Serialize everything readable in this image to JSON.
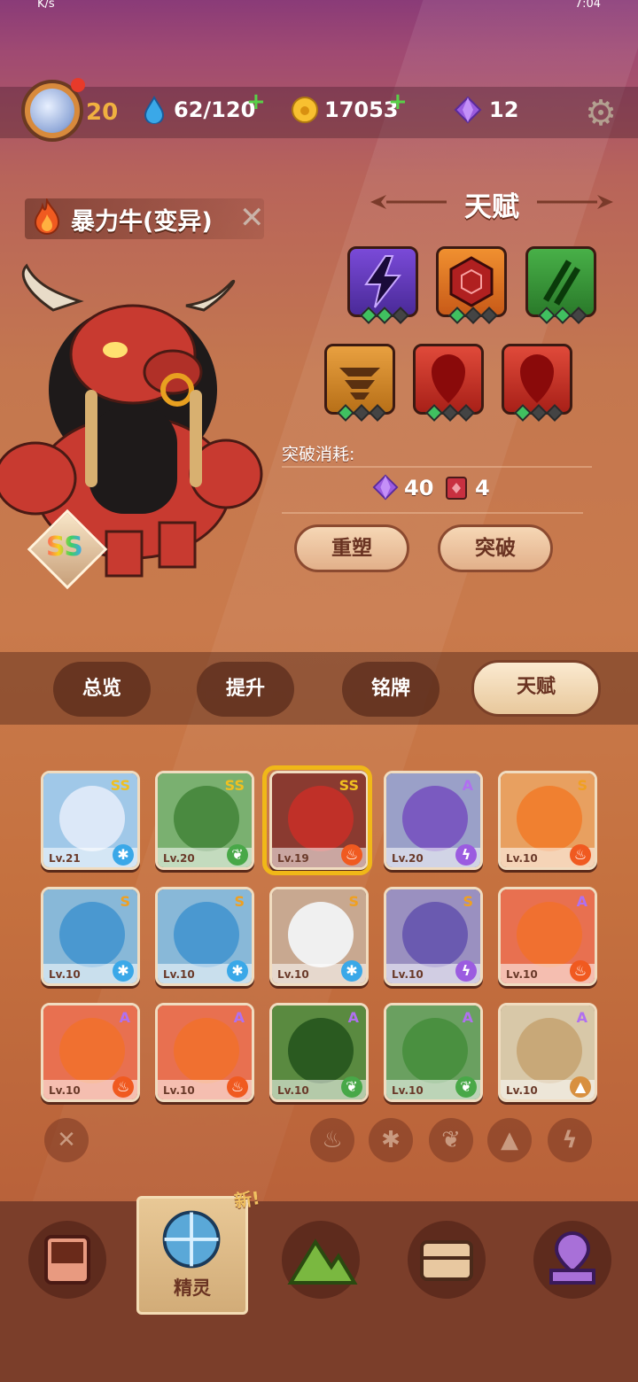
{
  "status_bar": {
    "left_text": "K/s",
    "right_text": "7:04"
  },
  "resources": {
    "player_level": "20",
    "water": "62/120",
    "gold": "17053",
    "gems": "12"
  },
  "pet": {
    "name": "暴力牛(变异)",
    "grade": "SS"
  },
  "talent": {
    "title": "天赋",
    "cost_label": "突破消耗:",
    "cost_gems": "40",
    "cost_books": "4",
    "reshape_label": "重塑",
    "breakthrough_label": "突破"
  },
  "tabs": [
    {
      "label": "总览"
    },
    {
      "label": "提升"
    },
    {
      "label": "铭牌"
    },
    {
      "label": "天赋"
    }
  ],
  "pets": [
    {
      "lv": "Lv.21",
      "grade": "SS",
      "element": "ice"
    },
    {
      "lv": "Lv.20",
      "grade": "SS",
      "element": "grass"
    },
    {
      "lv": "Lv.19",
      "grade": "SS",
      "element": "fire"
    },
    {
      "lv": "Lv.20",
      "grade": "A",
      "element": "thunder"
    },
    {
      "lv": "Lv.10",
      "grade": "S",
      "element": "fire"
    },
    {
      "lv": "Lv.10",
      "grade": "S",
      "element": "ice"
    },
    {
      "lv": "Lv.10",
      "grade": "S",
      "element": "ice"
    },
    {
      "lv": "Lv.10",
      "grade": "S",
      "element": "ice"
    },
    {
      "lv": "Lv.10",
      "grade": "S",
      "element": "thunder"
    },
    {
      "lv": "Lv.10",
      "grade": "A",
      "element": "fire"
    },
    {
      "lv": "Lv.10",
      "grade": "A",
      "element": "fire"
    },
    {
      "lv": "Lv.10",
      "grade": "A",
      "element": "fire"
    },
    {
      "lv": "Lv.10",
      "grade": "A",
      "element": "grass"
    },
    {
      "lv": "Lv.10",
      "grade": "A",
      "element": "grass"
    },
    {
      "lv": "Lv.10",
      "grade": "A",
      "element": "earth"
    }
  ],
  "nav": {
    "active_label": "精灵",
    "new_badge": "新!"
  },
  "colors": {
    "accent": "#f0b818",
    "plus": "#58d048",
    "gem": "#9b5ce0"
  }
}
